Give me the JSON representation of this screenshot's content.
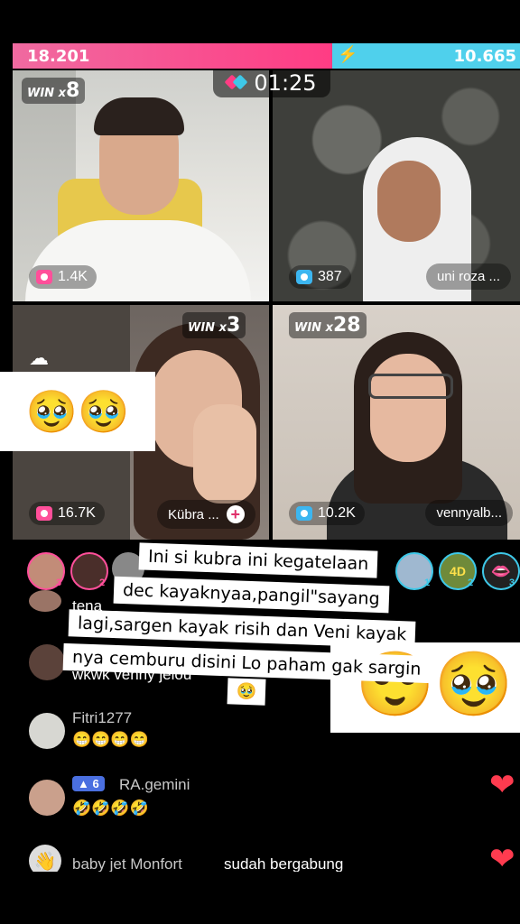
{
  "battle": {
    "left_score": "18.201",
    "right_score": "10.665",
    "left_fraction": 0.63,
    "timer": "01:25"
  },
  "tiles": [
    {
      "win_label": "WIN",
      "win_mult": "x",
      "win_count": "8",
      "viewers": "1.4K",
      "name": ""
    },
    {
      "win_label": "",
      "win_mult": "",
      "win_count": "",
      "viewers": "387",
      "name": "uni roza ..."
    },
    {
      "win_label": "WIN",
      "win_mult": "x",
      "win_count": "3",
      "viewers": "16.7K",
      "name": "Kübra ..."
    },
    {
      "win_label": "WIN",
      "win_mult": "x",
      "win_count": "28",
      "viewers": "10.2K",
      "name": "vennyalb..."
    }
  ],
  "gifters": {
    "left_ranks": [
      "3",
      "2"
    ],
    "right_ranks": [
      "1",
      "2",
      "3"
    ]
  },
  "comments": [
    {
      "user": "tena",
      "text": ""
    },
    {
      "user": "",
      "text": "wkwk venny jelou"
    },
    {
      "user": "Fitri1277",
      "text": "😁😁😁😁"
    },
    {
      "user": "RA.gemini",
      "level": "6",
      "text": "🤣🤣🤣🤣"
    },
    {
      "user": "baby jet Monfort",
      "text": "sudah bergabung"
    }
  ],
  "overlay": {
    "emoji_box": "🥹🥹",
    "caption_lines": [
      "Ini si kubra ini kegatelaan",
      "dec kayaknyaa,pangil\"sayang",
      "lagi,sargen kayak risih dan Veni kayak",
      "nya cemburu disini Lo paham gak sargin",
      "🥹"
    ],
    "big_emojis": "😌🥹"
  },
  "colors": {
    "bar_left": "#ff3c84",
    "bar_right": "#4fd0ec",
    "heart": "#ff3b4f"
  }
}
